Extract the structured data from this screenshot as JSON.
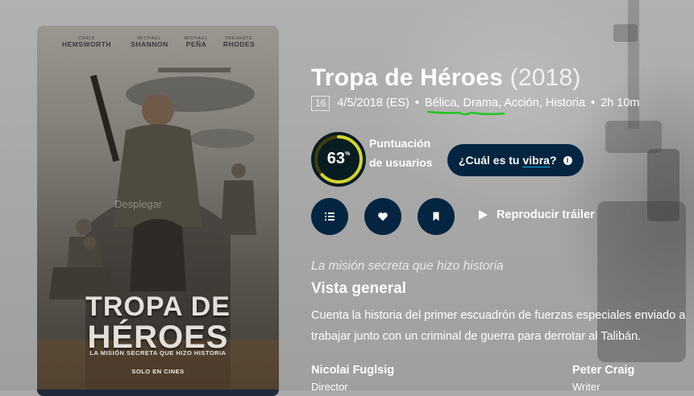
{
  "poster": {
    "cast": [
      {
        "first": "CHRIS",
        "last": "HEMSWORTH"
      },
      {
        "first": "MICHAEL",
        "last": "SHANNON"
      },
      {
        "first": "MICHAEL",
        "last": "PEÑA"
      },
      {
        "first": "TREVANTE",
        "last": "RHODES"
      }
    ],
    "title_line1": "TROPA DE",
    "title_line2": "HÉROES",
    "tagline": "LA MISIÓN SECRETA QUE HIZO HISTORIA",
    "release": "SOLO EN CINES",
    "watermark": "Desplegar"
  },
  "movie": {
    "title": "Tropa de Héroes",
    "year": "(2018)",
    "certification": "16",
    "release_date": "4/5/2018 (ES)",
    "genres": [
      "Bélica",
      "Drama",
      "Acción",
      "Historia"
    ],
    "runtime": "2h 10m"
  },
  "score": {
    "value": "63",
    "unit": "%",
    "percent": 63,
    "label": "Puntuación de usuarios"
  },
  "vibe": {
    "prefix": "¿Cuál es tu",
    "word": "vibra",
    "suffix": "?",
    "info": "i"
  },
  "actions": {
    "trailer_label": "Reproducir tráiler"
  },
  "overview": {
    "tagline": "La misión secreta que hizo historia",
    "heading": "Vista general",
    "line1": "Cuenta la historia del primer escuadrón de fuerzas especiales enviado a",
    "line2": "trabajar junto con un criminal de guerra para derrotar al Talibán."
  },
  "crew": [
    {
      "name": "Nicolai Fuglsig",
      "role": "Director"
    },
    {
      "name": "Peter Craig",
      "role": "Writer"
    }
  ],
  "colors": {
    "action_button": "#032541",
    "score_bg": "#081c22",
    "score_ring": "#d2d531",
    "score_track": "#423d0f",
    "annotation_underline": "#22c522"
  }
}
